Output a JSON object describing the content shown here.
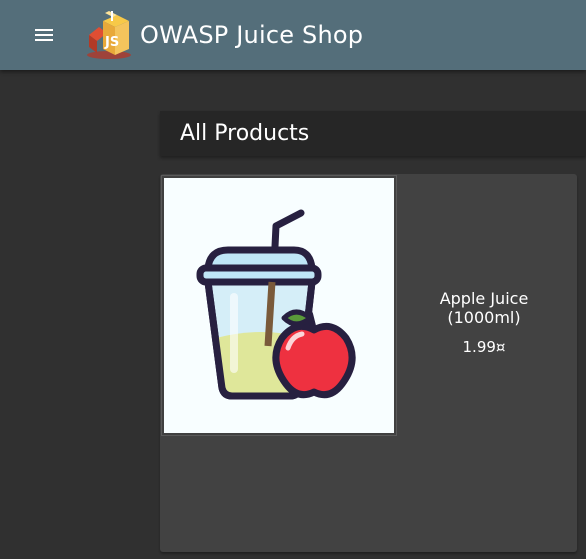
{
  "toolbar": {
    "title": "OWASP Juice Shop",
    "menu_icon": "menu-icon",
    "logo_icon": "juice-shop-logo"
  },
  "page": {
    "heading": "All Products"
  },
  "products": [
    {
      "name": "Apple Juice (1000ml)",
      "price": "1.99¤",
      "image_icon": "apple-juice-cup-icon"
    }
  ],
  "colors": {
    "toolbar": "#546e7a",
    "background": "#303030",
    "card": "#424242",
    "heading_bar": "#262626"
  }
}
